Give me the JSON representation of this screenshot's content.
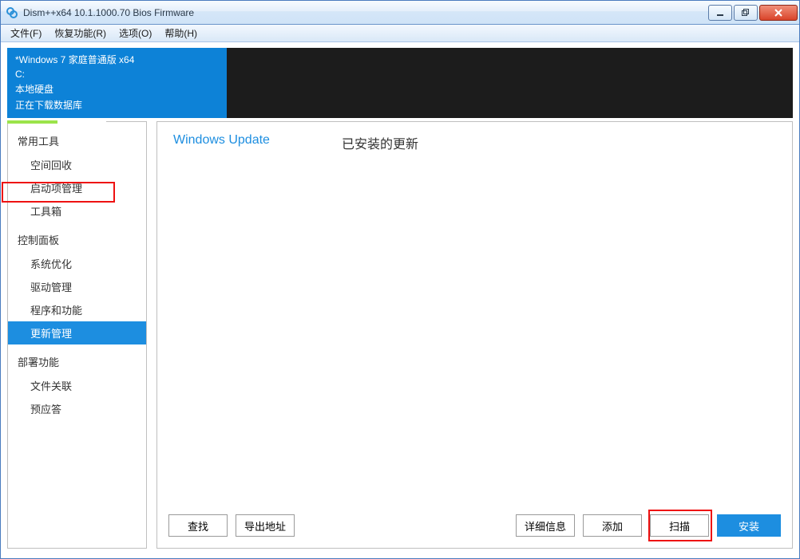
{
  "window": {
    "title": "Dism++x64 10.1.1000.70 Bios Firmware"
  },
  "menu": {
    "file": "文件(F)",
    "recovery": "恢复功能(R)",
    "options": "选项(O)",
    "help": "帮助(H)"
  },
  "header": {
    "os": "*Windows 7 家庭普通版 x64",
    "drive": "C:",
    "disk": "本地硬盘",
    "status": "正在下载数据库"
  },
  "sidebar": {
    "group1": "常用工具",
    "items1": [
      "空间回收",
      "启动项管理",
      "工具箱"
    ],
    "group2": "控制面板",
    "items2": [
      "系统优化",
      "驱动管理",
      "程序和功能",
      "更新管理"
    ],
    "group3": "部署功能",
    "items3": [
      "文件关联",
      "预应答"
    ],
    "selected": "更新管理"
  },
  "tabs": {
    "windows_update": "Windows Update",
    "installed": "已安装的更新"
  },
  "buttons": {
    "find": "查找",
    "export": "导出地址",
    "details": "详细信息",
    "add": "添加",
    "scan": "扫描",
    "install": "安装"
  }
}
